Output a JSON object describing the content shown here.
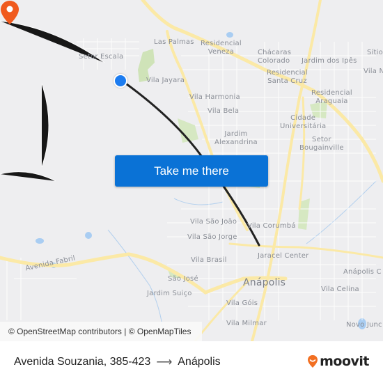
{
  "map": {
    "labels": [
      {
        "id": "setor-escala",
        "text": "Setor Escala"
      },
      {
        "id": "las-palmas",
        "text": "Las Palmas"
      },
      {
        "id": "residencial-veneza",
        "text": "Residencial\nVeneza"
      },
      {
        "id": "chacaras-colorado",
        "text": "Chácaras\nColorado"
      },
      {
        "id": "jardim-dos-ipes",
        "text": "Jardim dos Ipês"
      },
      {
        "id": "sitio",
        "text": "Sítio"
      },
      {
        "id": "vila-n",
        "text": "Vila N"
      },
      {
        "id": "residencial-santa-cruz",
        "text": "Residencial\nSanta Cruz"
      },
      {
        "id": "vila-jayara",
        "text": "Vila Jayara"
      },
      {
        "id": "vila-harmonia",
        "text": "Vila Harmonia"
      },
      {
        "id": "residencial-araguaia",
        "text": "Residencial\nAraguaia"
      },
      {
        "id": "vila-bela",
        "text": "Vila Bela"
      },
      {
        "id": "cidade-universitaria",
        "text": "Cidade\nUniversitária"
      },
      {
        "id": "jardim-alexandrina",
        "text": "Jardim\nAlexandrina"
      },
      {
        "id": "setor-bougainville",
        "text": "Setor\nBougainville"
      },
      {
        "id": "vila-sao-joao",
        "text": "Vila São João"
      },
      {
        "id": "vila-corumba",
        "text": "Vila Corumbá"
      },
      {
        "id": "vila-sao-jorge",
        "text": "Vila São Jorge"
      },
      {
        "id": "avenida-fabril",
        "text": "Avenida Fabril"
      },
      {
        "id": "vila-brasil",
        "text": "Vila Brasil"
      },
      {
        "id": "jaracel-center",
        "text": "Jaracel Center"
      },
      {
        "id": "anapolis-c",
        "text": "Anápolis C"
      },
      {
        "id": "sao-jose",
        "text": "São José"
      },
      {
        "id": "anapolis",
        "text": "Anápolis"
      },
      {
        "id": "vila-celina",
        "text": "Vila Celina"
      },
      {
        "id": "jardim-suico",
        "text": "Jardim Suiço"
      },
      {
        "id": "vila-gois",
        "text": "Vila Góis"
      },
      {
        "id": "vila-milmar",
        "text": "Vila Milmar"
      },
      {
        "id": "novo-junc",
        "text": "Novo Junc"
      }
    ],
    "origin": {
      "name": "Avenida Souzania, 385-423",
      "color": "#1c7cf0"
    },
    "destination": {
      "name": "Anápolis",
      "color": "#f05a1e"
    },
    "route_color": "#222222",
    "cta_label": "Take me there",
    "attribution": "© OpenStreetMap contributors | © OpenMapTiles"
  },
  "footer": {
    "origin": "Avenida Souzania, 385-423",
    "arrow": "⟶",
    "destination": "Anápolis",
    "brand": "moovit",
    "brand_color": "#f26f21"
  }
}
